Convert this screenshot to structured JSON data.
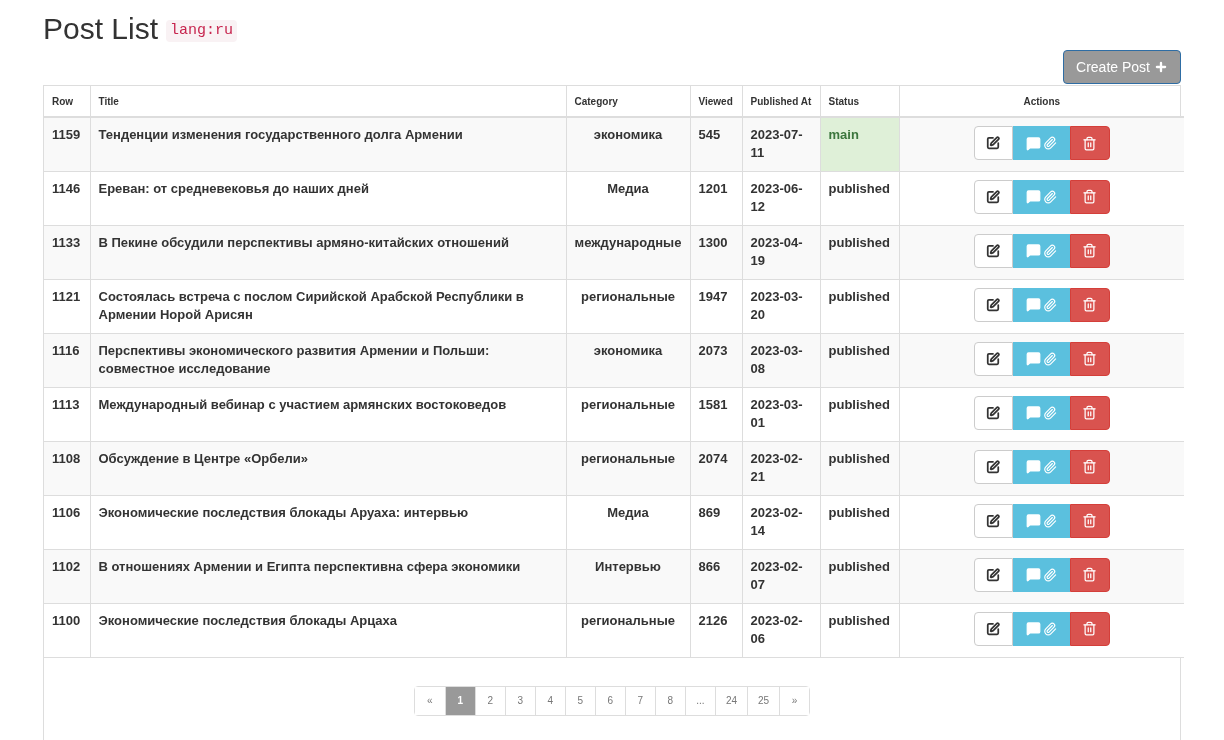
{
  "header": {
    "title": "Post List",
    "lang_tag": "lang:ru"
  },
  "create_button": {
    "label": "Create Post"
  },
  "table": {
    "columns": [
      "Row",
      "Title",
      "Category",
      "Viewed",
      "Published At",
      "Status",
      "Actions"
    ],
    "rows": [
      {
        "row": "1159",
        "title": "Тенденции изменения государственного долга Армении",
        "category": "экономика",
        "viewed": "545",
        "published_at": "2023-07-11",
        "status": "main",
        "kind": "highlighted"
      },
      {
        "row": "1146",
        "title": "Ереван: от средневековья до наших дней",
        "category": "Медиа",
        "viewed": "1201",
        "published_at": "2023-06-12",
        "status": "published",
        "kind": "plain"
      },
      {
        "row": "1133",
        "title": "В Пекине обсудили перспективы армяно-китайских отношений",
        "category": "международные",
        "viewed": "1300",
        "published_at": "2023-04-19",
        "status": "published",
        "kind": "plain"
      },
      {
        "row": "1121",
        "title": "Состоялась встреча с послом Сирийской Арабской Республики в Армении Норой Арисян",
        "category": "региональные",
        "viewed": "1947",
        "published_at": "2023-03-20",
        "status": "published",
        "kind": "plain"
      },
      {
        "row": "1116",
        "title": "Перспективы экономического развития Армении и Польши: совместное исследование",
        "category": "экономика",
        "viewed": "2073",
        "published_at": "2023-03-08",
        "status": "published",
        "kind": "plain"
      },
      {
        "row": "1113",
        "title": "Международный вебинар с участием армянских востоковедов",
        "category": "региональные",
        "viewed": "1581",
        "published_at": "2023-03-01",
        "status": "published",
        "kind": "plain"
      },
      {
        "row": "1108",
        "title": "Обсуждение в Центре «Орбели»",
        "category": "региональные",
        "viewed": "2074",
        "published_at": "2023-02-21",
        "status": "published",
        "kind": "plain"
      },
      {
        "row": "1106",
        "title": "Экономические последствия блокады Аруаха: интервью",
        "category": "Медиа",
        "viewed": "869",
        "published_at": "2023-02-14",
        "status": "published",
        "kind": "plain"
      },
      {
        "row": "1102",
        "title": "В отношениях Армении и Египта перспективна сфера экономики",
        "category": "Интервью",
        "viewed": "866",
        "published_at": "2023-02-07",
        "status": "published",
        "kind": "plain"
      },
      {
        "row": "1100",
        "title": "Экономические последствия блокады Арцаха",
        "category": "региональные",
        "viewed": "2126",
        "published_at": "2023-02-06",
        "status": "published",
        "kind": "plain"
      }
    ]
  },
  "pagination": [
    {
      "label": "«",
      "selected": false
    },
    {
      "label": "1",
      "selected": true
    },
    {
      "label": "2",
      "selected": false
    },
    {
      "label": "3",
      "selected": false
    },
    {
      "label": "4",
      "selected": false
    },
    {
      "label": "5",
      "selected": false
    },
    {
      "label": "6",
      "selected": false
    },
    {
      "label": "7",
      "selected": false
    },
    {
      "label": "8",
      "selected": false
    },
    {
      "label": "...",
      "selected": false
    },
    {
      "label": "24",
      "selected": false
    },
    {
      "label": "25",
      "selected": false
    },
    {
      "label": "»",
      "selected": false
    }
  ]
}
